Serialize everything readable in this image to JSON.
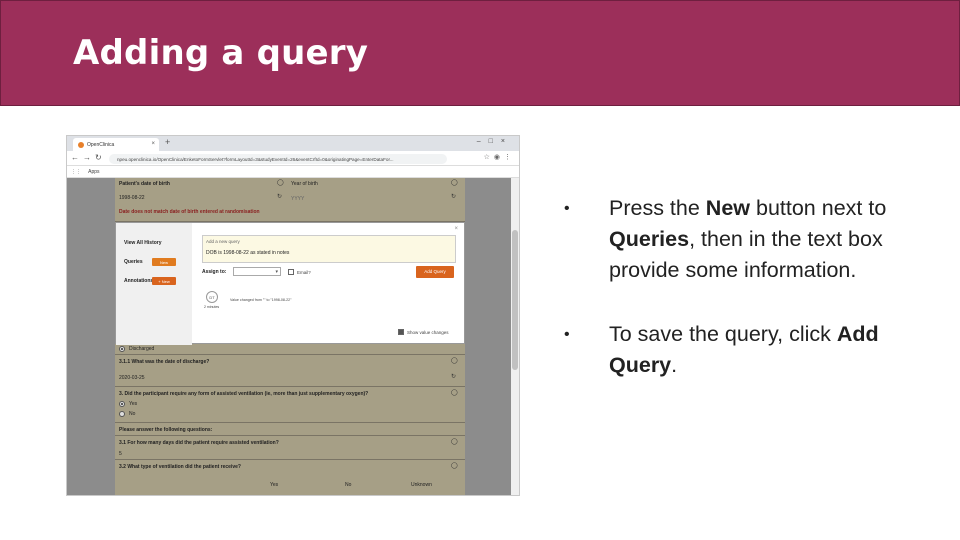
{
  "slide": {
    "title": "Adding a query",
    "title_bar_color": "#9c2f5a"
  },
  "browser": {
    "tab_title": "OpenClinica",
    "url": "npeu.openclinica.io/OpenClinica/EnketoFormServlet?formLayoutId=3&studyEventId=26&eventCrfId=0&originatingPage=EnterDataFor...",
    "bookmark_apps": "Apps"
  },
  "form": {
    "dob_label": "Patient's date of birth",
    "dob_value": "1998-08-22",
    "dob_warning": "Date does not match date of birth entered at randomisation",
    "yob_label": "Year of birth",
    "yob_placeholder": "YYYY",
    "discharged": "Discharged",
    "q_discharge_date": "3.1.1 What was the date of discharge?",
    "discharge_date": "2020-03-25",
    "q_ventilation": "3. Did the participant require any form of assisted ventilation (ie, more than just supplementary oxygen)?",
    "opt_yes": "Yes",
    "opt_no": "No",
    "instruction": "Please answer the following questions:",
    "q_days": "3.1 For how many days did the patient require assisted ventilation?",
    "days_value": "5",
    "q_type": "3.2 What type of ventilation did the patient receive?",
    "col_yes": "Yes",
    "col_no": "No",
    "col_unknown": "Unknown"
  },
  "modal": {
    "view_history": "View All History",
    "queries": "Queries",
    "annotations": "Annotations",
    "new_btn": "New",
    "new_btn_plus": "+ New",
    "query_placeholder": "Add a new query",
    "query_value": "DOB is 1998-08-22 as stated in notes",
    "assign_to": "Assign to:",
    "email": "Email?",
    "add_query_btn": "Add Query",
    "avatar_initials": "DT",
    "avatar_time": "2 minutes",
    "value_changed": "Value changed from \"\" to \"1998-08-22\"",
    "show_value_changes": "Show value changes"
  },
  "bullets": {
    "b1_pre": "Press the ",
    "b1_new": "New",
    "b1_mid": " button next to ",
    "b1_queries": "Queries",
    "b1_post": ", then in the text box provide some information.",
    "b2_pre": "To save the query, click ",
    "b2_add": "Add Query",
    "b2_post": "."
  }
}
